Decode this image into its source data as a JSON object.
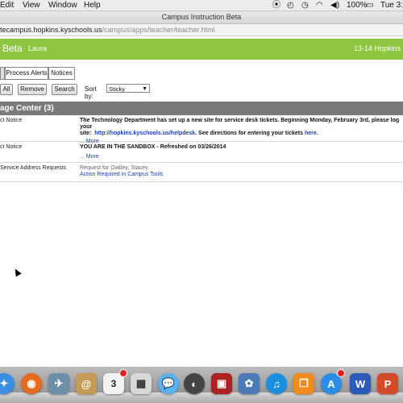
{
  "menubar": {
    "menus": [
      "Edit",
      "View",
      "Window",
      "Help"
    ],
    "battery": "100%",
    "clock": "Tue 3:"
  },
  "window": {
    "title": "Campus Instruction Beta",
    "url_host": "tecampus.hopkins.kyschools.us",
    "url_path": "/campus/apps/teacher/teacher.html"
  },
  "appbar": {
    "beta_label": "Beta",
    "user": "Laura",
    "year": "13-14 Hopkins"
  },
  "tabs": [
    "Process Alerts",
    "Notices"
  ],
  "actions": {
    "all": "All",
    "remove": "Remove",
    "search": "Search",
    "sort_label": "Sort by:",
    "sort_value": "Sticky"
  },
  "message_center": {
    "title": "age Center (3)",
    "rows": [
      {
        "type": "ct Notice",
        "text": "The Technology Department has set up a new site for service desk tickets. Beginning Monday, February 3rd, please log your",
        "text2_prefix": "site:",
        "link": "http://hopkins.kyschools.us/helpdesk",
        "text2_suffix": ". See directions for entering your tickets",
        "here": "here.",
        "more": "... More"
      },
      {
        "type": "ct Notice",
        "text": "YOU ARE IN THE SANDBOX - Refreshed on 03/26/2014",
        "more": "... More"
      },
      {
        "type": "Service Address Requests",
        "request": "Request for Oakley, Stacey",
        "action": "Action Required in Campus Tools"
      }
    ]
  },
  "dock": {
    "calendar_day": "3",
    "colors": {
      "finder": "#3a8ee6",
      "firefox": "#e66a1f",
      "itunes": "#1a8fe0",
      "ibooks": "#f08a1c",
      "appstore": "#2a8de8",
      "word": "#2a5bb8",
      "powerpoint": "#d24a26"
    }
  }
}
